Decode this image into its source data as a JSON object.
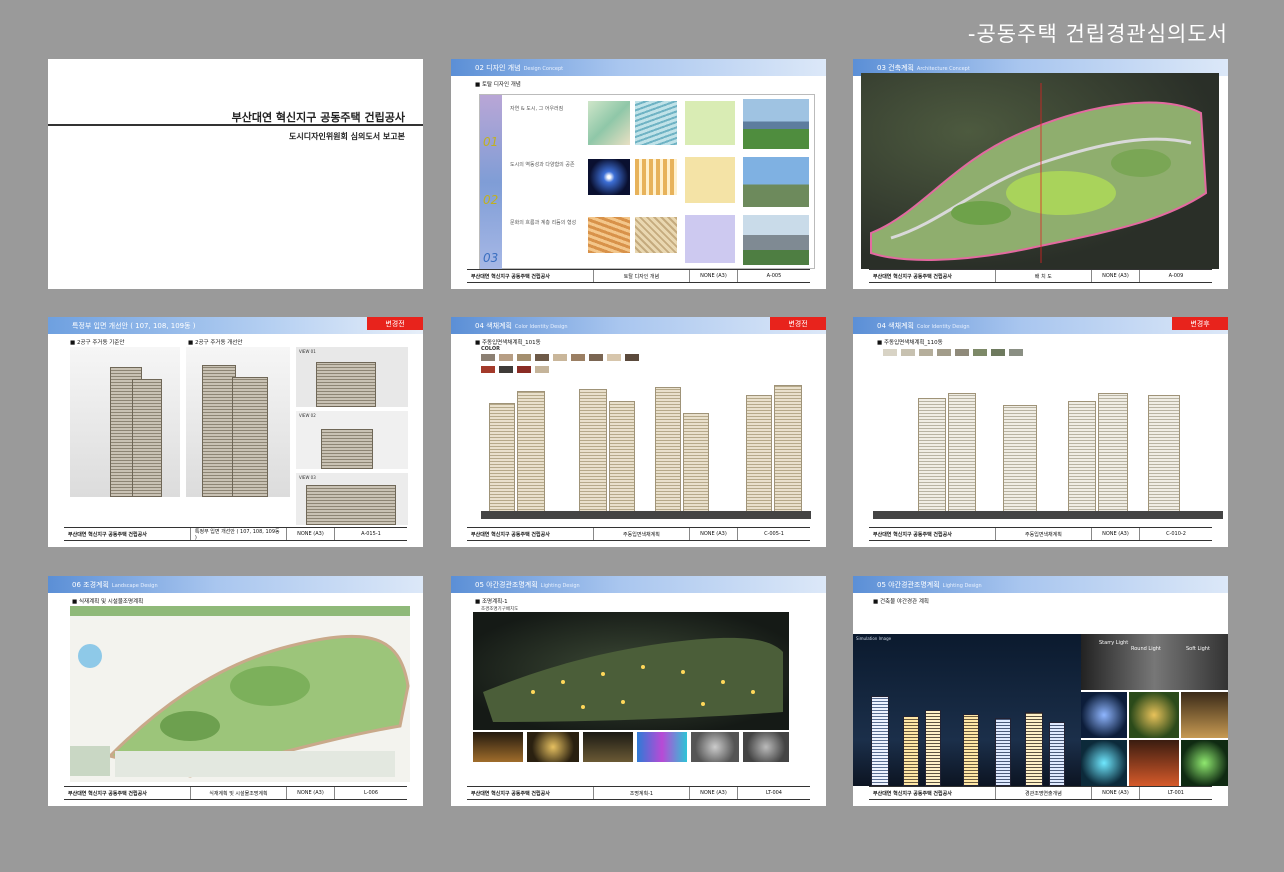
{
  "page_title": "-공동주택 건립경관심의도서",
  "cover": {
    "title": "부산대연 혁신지구 공동주택 건립공사",
    "subtitle": "도시디자인위원회 심의도서 보고본"
  },
  "footer_project": "부산대연 혁신지구 공동주택 건립공사",
  "footer_scale": "NONE (A3)",
  "sheets": {
    "design": {
      "header": "02 디자인 개념",
      "header_en": "Design Concept",
      "section": "토탈 디자인 개념",
      "rows": [
        {
          "num": "01",
          "side": "Nature",
          "caption": "자연 & 도시, 그 어우러짐"
        },
        {
          "num": "02",
          "side": "Urban",
          "caption": "도시의 역동성과 다양함의 공존"
        },
        {
          "num": "03",
          "side": "Culture",
          "caption": "문화의 흐름과 계층 리듬의 형성"
        }
      ],
      "footer_title": "토탈 디자인 개념",
      "footer_code": "A-005"
    },
    "arch": {
      "header": "03 건축계획",
      "header_en": "Architecture Concept",
      "footer_title": "배 치 도",
      "footer_code": "A-009"
    },
    "elev": {
      "header": "특정부 입면 개선안 ( 107, 108, 109동 )",
      "badge": "변경전",
      "left_label": "2공구 주거동 기준안",
      "right_label": "2공구 주거동 개선안",
      "views": [
        "VIEW 01",
        "VIEW 02",
        "VIEW 03"
      ],
      "footer_title": "특정부 입면 개선안 ( 107, 108, 109동 )",
      "footer_code": "A-015-1"
    },
    "color1": {
      "header": "04 색채계획",
      "header_en": "Color Identity Design",
      "badge": "변경전",
      "section": "주동입면색채계획_101동",
      "sub": "COLOR",
      "footer_title": "주동입면색채계획",
      "footer_code": "C-005-1"
    },
    "color2": {
      "header": "04 색채계획",
      "header_en": "Color Identity Design",
      "badge": "변경후",
      "section": "주동입면색채계획_110동",
      "footer_title": "주동입면색채계획",
      "footer_code": "C-010-2"
    },
    "landscape": {
      "header": "06 조경계획",
      "header_en": "Landscape Design",
      "section": "식재계획 및 시설물조명계획",
      "footer_title": "식재계획 및 시설물조명계획",
      "footer_code": "L-006"
    },
    "lighting1": {
      "header": "05 야간경관조명계획",
      "header_en": "Lighting Design",
      "section": "조명계획-1",
      "sub": "조경조명기구배치도",
      "footer_title": "조명계획-1",
      "footer_code": "LT-004"
    },
    "lighting2": {
      "header": "05 야간경관조명계획",
      "header_en": "Lighting Design",
      "section": "건축물 야간경관 계획",
      "labels": [
        "Starry Light",
        "Round Light",
        "Soft Light",
        "Simulation Image"
      ],
      "footer_title": "경관조명연출개념",
      "footer_code": "LT-001"
    }
  },
  "colors": {
    "background": "#9a9a9a",
    "header_blue": "#5b8fd6",
    "badge_red": "#e8231c"
  }
}
